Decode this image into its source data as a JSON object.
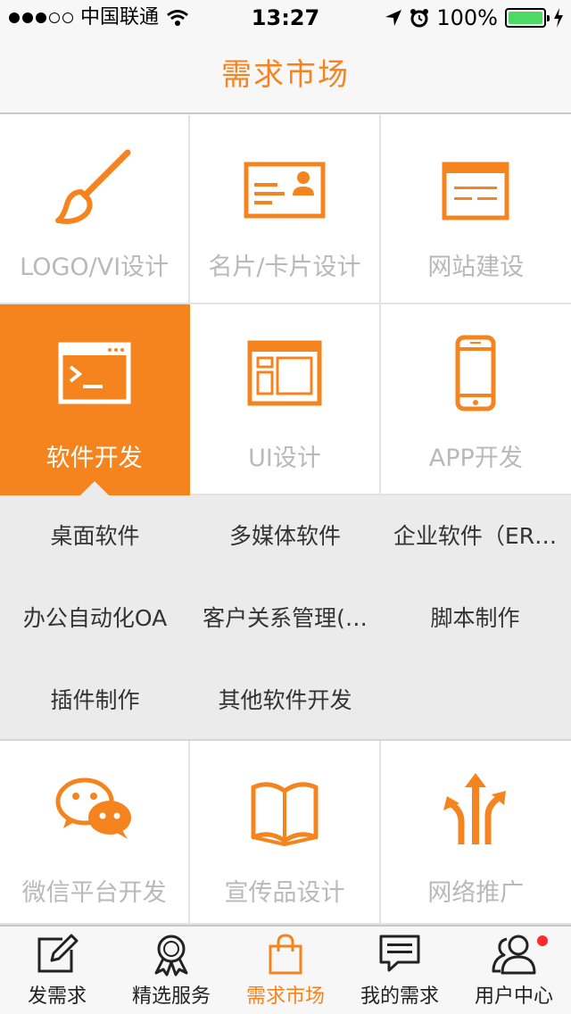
{
  "status_bar": {
    "carrier": "中国联通",
    "time": "13:27",
    "battery": "100%"
  },
  "nav": {
    "title": "需求市场"
  },
  "categories": [
    {
      "label": "LOGO/VI设计",
      "icon": "brush-icon"
    },
    {
      "label": "名片/卡片设计",
      "icon": "business-card-icon"
    },
    {
      "label": "网站建设",
      "icon": "browser-window-icon"
    },
    {
      "label": "软件开发",
      "icon": "terminal-icon",
      "active": true
    },
    {
      "label": "UI设计",
      "icon": "layout-icon"
    },
    {
      "label": "APP开发",
      "icon": "smartphone-icon"
    },
    {
      "label": "微信平台开发",
      "icon": "wechat-icon"
    },
    {
      "label": "宣传品设计",
      "icon": "open-book-icon"
    },
    {
      "label": "网络推广",
      "icon": "arrows-split-icon"
    }
  ],
  "submenu": [
    "桌面软件",
    "多媒体软件",
    "企业软件（ER…",
    "办公自动化OA",
    "客户关系管理(…",
    "脚本制作",
    "插件制作",
    "其他软件开发"
  ],
  "tabs": [
    {
      "label": "发需求",
      "icon": "edit-icon"
    },
    {
      "label": "精选服务",
      "icon": "award-ribbon-icon"
    },
    {
      "label": "需求市场",
      "icon": "shopping-bag-icon",
      "active": true
    },
    {
      "label": "我的需求",
      "icon": "message-icon"
    },
    {
      "label": "用户中心",
      "icon": "users-icon",
      "badge": true
    }
  ],
  "colors": {
    "accent": "#f5841f",
    "badge": "#ff2a2a"
  }
}
